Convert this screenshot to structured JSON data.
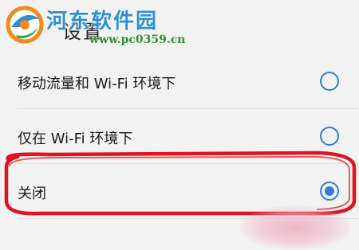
{
  "header": {
    "title": "设置",
    "back_icon": "back-arrow-icon"
  },
  "watermark": {
    "site_name": "河东软件园",
    "url": "www.pc0359.cn",
    "logo_icon": "watermark-logo-icon",
    "title_color": "#2e8fd6",
    "url_color": "#2f8f2f"
  },
  "options": [
    {
      "label": "移动流量和 Wi-Fi 环境下",
      "selected": false
    },
    {
      "label": "仅在 Wi-Fi 环境下",
      "selected": false
    },
    {
      "label": "关闭",
      "selected": true
    }
  ],
  "colors": {
    "radio_accent": "#2f7fd8",
    "annotation_red": "#e0141e",
    "background": "#f2f2f2"
  }
}
